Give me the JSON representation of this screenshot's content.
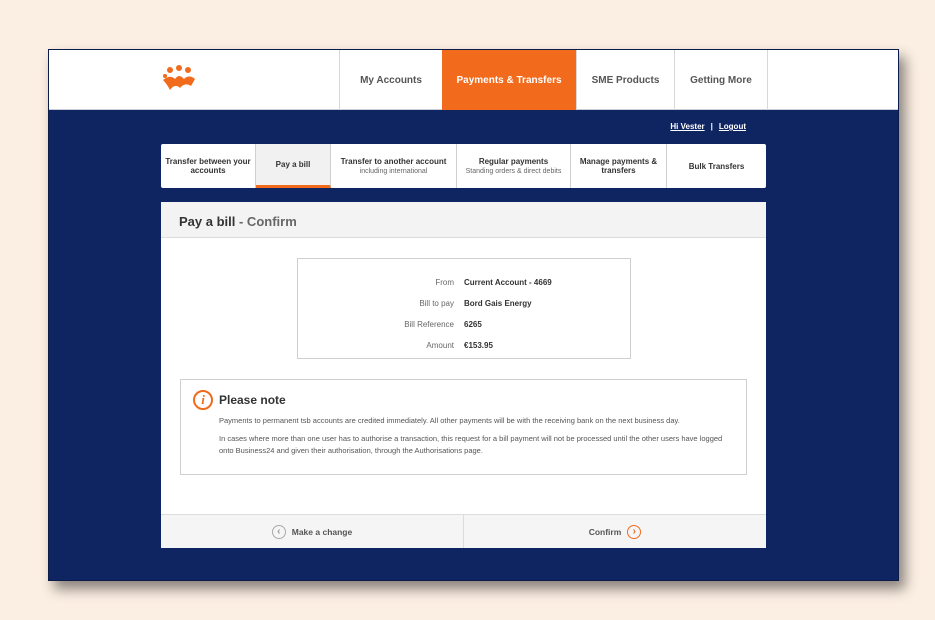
{
  "nav": {
    "logo": "logo-icon",
    "items": [
      {
        "label": "My Accounts",
        "active": false
      },
      {
        "label": "Payments & Transfers",
        "active": true
      },
      {
        "label": "SME Products",
        "active": false
      },
      {
        "label": "Getting More",
        "active": false
      }
    ]
  },
  "user": {
    "greeting": "Hi Vester",
    "separator": "|",
    "logout": "Logout"
  },
  "subnav": [
    {
      "label": "Transfer between your accounts",
      "sub": ""
    },
    {
      "label": "Pay a bill",
      "sub": ""
    },
    {
      "label": "Transfer to another account",
      "sub": "including international"
    },
    {
      "label": "Regular payments",
      "sub": "Standing orders & direct debits"
    },
    {
      "label": "Manage payments & transfers",
      "sub": ""
    },
    {
      "label": "Bulk Transfers",
      "sub": ""
    }
  ],
  "panel": {
    "title": "Pay a bill",
    "subtitle": " - Confirm"
  },
  "details": [
    {
      "label": "From",
      "value": "Current Account - 4669"
    },
    {
      "label": "Bill to pay",
      "value": "Bord Gais Energy"
    },
    {
      "label": "Bill Reference",
      "value": "6265"
    },
    {
      "label": "Amount",
      "value": "€153.95"
    }
  ],
  "note": {
    "title": "Please note",
    "icon": "info-icon",
    "line1": "Payments to permanent tsb accounts are credited immediately. All other payments will be with the receiving bank on the next business day.",
    "line2": "In cases where more than one user has to authorise a transaction, this request for a bill payment will not be processed until the other users have logged onto Business24 and given their authorisation, through the Authorisations page."
  },
  "actions": {
    "change": "Make a change",
    "confirm": "Confirm"
  },
  "colors": {
    "accent": "#f26b1d",
    "navy": "#0f2562",
    "page_bg": "#fbeee2"
  }
}
